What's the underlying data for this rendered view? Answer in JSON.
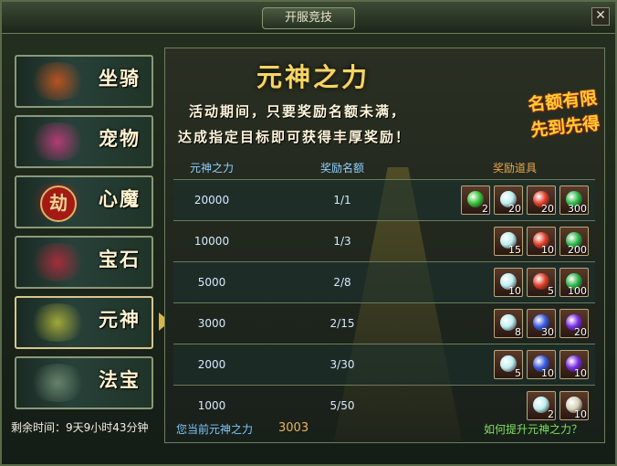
{
  "window": {
    "title": "开服竞技",
    "close": "✕"
  },
  "sidebar": {
    "items": [
      {
        "label": "坐骑",
        "art": "mount-icon"
      },
      {
        "label": "宠物",
        "art": "pet-icon"
      },
      {
        "label": "心魔",
        "art": "demon-seal-icon",
        "badge": "劫"
      },
      {
        "label": "宝石",
        "art": "gem-icon"
      },
      {
        "label": "元神",
        "art": "spirit-icon",
        "active": true
      },
      {
        "label": "法宝",
        "art": "treasure-icon"
      }
    ]
  },
  "status": {
    "remaining": "剩余时间：9天9小时43分钟"
  },
  "panel": {
    "title": "元神之力",
    "desc1": "活动期间，只要奖励名额未满，",
    "desc2": "达成指定目标即可获得丰厚奖励！",
    "stamp1": "名额有限",
    "stamp2": "先到先得",
    "columns": [
      "元神之力",
      "奖励名额",
      "奖励道具"
    ],
    "rows": [
      {
        "power": "20000",
        "quota": "1/1",
        "items": [
          {
            "icon": "green-gem-icon",
            "count": "2",
            "color": "#3cc43c"
          },
          {
            "icon": "cyan-orb-icon",
            "count": "20",
            "color": "#bfeef0"
          },
          {
            "icon": "red-crystal-icon",
            "count": "20",
            "color": "#e0402a"
          },
          {
            "icon": "green-pearl-icon",
            "count": "300",
            "color": "#2fb84a"
          }
        ]
      },
      {
        "power": "10000",
        "quota": "1/3",
        "items": [
          {
            "icon": "cyan-orb-icon",
            "count": "15",
            "color": "#bfeef0"
          },
          {
            "icon": "red-crystal-icon",
            "count": "10",
            "color": "#e0402a"
          },
          {
            "icon": "green-pearl-icon",
            "count": "200",
            "color": "#2fb84a"
          }
        ]
      },
      {
        "power": "5000",
        "quota": "2/8",
        "items": [
          {
            "icon": "cyan-orb-icon",
            "count": "10",
            "color": "#bfeef0"
          },
          {
            "icon": "red-crystal-icon",
            "count": "5",
            "color": "#e0402a"
          },
          {
            "icon": "green-pearl-icon",
            "count": "100",
            "color": "#2fb84a"
          }
        ]
      },
      {
        "power": "3000",
        "quota": "2/15",
        "items": [
          {
            "icon": "cyan-orb-icon",
            "count": "8",
            "color": "#bfeef0"
          },
          {
            "icon": "blue-orb-icon",
            "count": "30",
            "color": "#3c5de0"
          },
          {
            "icon": "purple-orb-icon",
            "count": "20",
            "color": "#7a2ee0"
          }
        ]
      },
      {
        "power": "2000",
        "quota": "3/30",
        "items": [
          {
            "icon": "cyan-orb-icon",
            "count": "5",
            "color": "#bfeef0"
          },
          {
            "icon": "blue-orb-icon",
            "count": "10",
            "color": "#3c5de0"
          },
          {
            "icon": "purple-orb-icon",
            "count": "10",
            "color": "#7a2ee0"
          }
        ]
      },
      {
        "power": "1000",
        "quota": "5/50",
        "items": [
          {
            "icon": "cyan-orb-icon",
            "count": "2",
            "color": "#bfeef0"
          },
          {
            "icon": "scroll-icon",
            "count": "10",
            "color": "#d8d2b8"
          }
        ]
      }
    ],
    "current_label": "您当前元神之力",
    "current_value": "3003",
    "help_link": "如何提升元神之力？"
  }
}
